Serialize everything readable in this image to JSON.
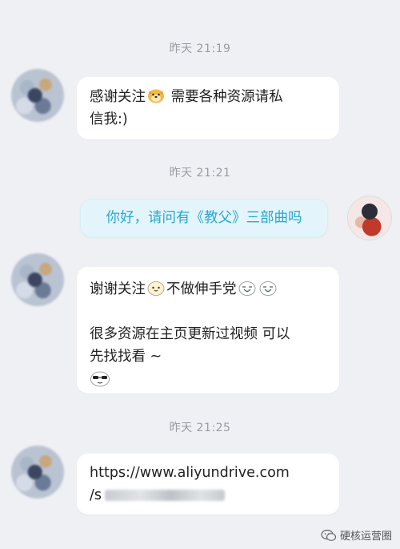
{
  "timestamps": [
    "昨天 21:19",
    "昨天 21:21",
    "昨天 21:25"
  ],
  "messages": [
    {
      "line1_a": "感谢关注",
      "line1_b": "需要各种资源请私",
      "line2": "信我:)"
    },
    {
      "text": "你好，请问有《教父》三部曲吗"
    },
    {
      "line1_a": "谢谢关注",
      "line1_b": "不做伸手党",
      "line2": "很多资源在主页更新过视频 可以",
      "line3": "先找找看 ~"
    },
    {
      "line1": "https://www.aliyundrive.com",
      "line2_prefix": "/s"
    }
  ],
  "watermark": {
    "text": "硬核运营圈",
    "icon": "wechat-icon"
  },
  "colors": {
    "background": "#eff0f4",
    "mine_bubble": "#e3f5fb",
    "mine_text": "#2aa7d2"
  }
}
